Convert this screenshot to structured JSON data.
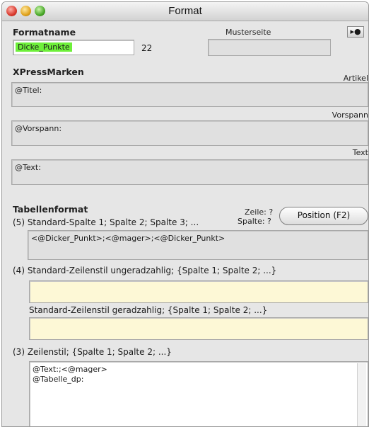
{
  "window": {
    "title": "Format"
  },
  "formatname": {
    "label": "Formatname",
    "value": "Dicke_Punkte",
    "count": "22"
  },
  "musterseite": {
    "label": "Musterseite",
    "value": "",
    "button": "▸●"
  },
  "xpress": {
    "heading": "XPressMarken",
    "artikel": {
      "label": "Artikel",
      "value": "@Titel:"
    },
    "vorspann": {
      "label": "Vorspann",
      "value": "@Vorspann:"
    },
    "text": {
      "label": "Text",
      "value": "@Text:"
    }
  },
  "tabellen": {
    "heading": "Tabellenformat",
    "zeile": "Zeile: ?",
    "spalte": "Spalte: ?",
    "position_button": "Position (F2)",
    "standard_spalte": {
      "label": "(5) Standard-Spalte 1; Spalte 2; Spalte 3; ...",
      "value": "<@Dicker_Punkt>;<@mager>;<@Dicker_Punkt>"
    },
    "ungerade": {
      "label": "(4) Standard-Zeilenstil ungeradzahlig; {Spalte 1; Spalte 2; ...}",
      "value": ""
    },
    "gerade": {
      "label": "Standard-Zeilenstil geradzahlig; {Spalte 1; Spalte 2; ...}",
      "value": ""
    },
    "zeilenstil": {
      "label": "(3) Zeilenstil; {Spalte 1; Spalte 2; ...}",
      "lines": [
        "@Text:;<@mager>",
        "@Tabelle_dp:"
      ]
    }
  },
  "colors": {
    "highlight": "#6ef03a",
    "yellow_field": "#fdf8d6",
    "window_bg": "#e6e6e6"
  }
}
